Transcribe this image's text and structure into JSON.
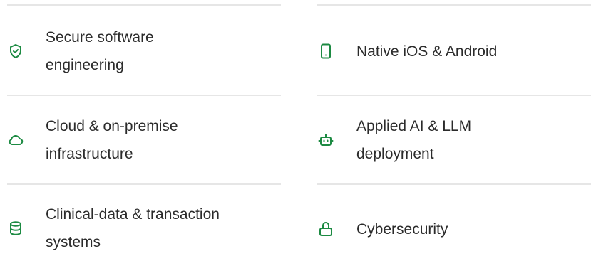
{
  "features": {
    "left": [
      {
        "label": "Secure software\nengineering",
        "icon": "shield-check-icon"
      },
      {
        "label": "Cloud & on-premise\ninfrastructure",
        "icon": "cloud-icon"
      },
      {
        "label": "Clinical-data & transaction\nsystems",
        "icon": "database-icon"
      }
    ],
    "right": [
      {
        "label": "Native iOS & Android",
        "icon": "smartphone-icon"
      },
      {
        "label": "Applied AI & LLM\ndeployment",
        "icon": "robot-icon"
      },
      {
        "label": "Cybersecurity",
        "icon": "lock-icon"
      }
    ]
  },
  "colors": {
    "accent": "#1c8a42",
    "text": "#2b2b2b",
    "divider": "#e6e6e6"
  }
}
